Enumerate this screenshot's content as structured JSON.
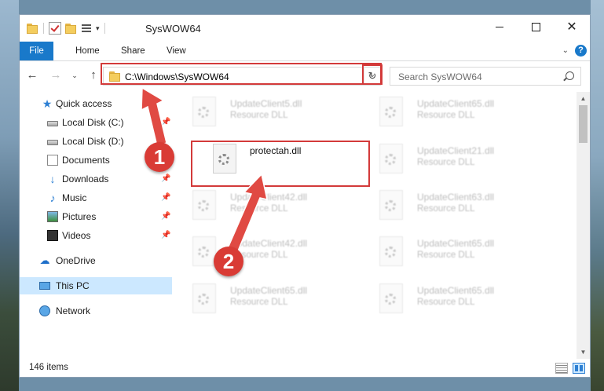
{
  "window": {
    "title": "SysWOW64",
    "qa_dropdown": "▾"
  },
  "ribbon": {
    "tabs": [
      {
        "label": "File"
      },
      {
        "label": "Home"
      },
      {
        "label": "Share"
      },
      {
        "label": "View"
      }
    ],
    "help": "?"
  },
  "nav": {
    "back": "←",
    "forward": "→",
    "recent": "⌄",
    "up": "↑",
    "address": "C:\\Windows\\SysWOW64",
    "address_dropdown": "⌄",
    "refresh": "↻",
    "search_placeholder": "Search SysWOW64"
  },
  "sidebar": {
    "items": [
      {
        "label": "Quick access",
        "icon": "star-icon"
      },
      {
        "label": "Local Disk (C:)",
        "icon": "drive-icon",
        "pinned": true
      },
      {
        "label": "Local Disk (D:)",
        "icon": "drive-icon",
        "pinned": false
      },
      {
        "label": "Documents",
        "icon": "documents-icon",
        "pinned": true
      },
      {
        "label": "Downloads",
        "icon": "download-icon",
        "pinned": true
      },
      {
        "label": "Music",
        "icon": "music-icon",
        "pinned": true
      },
      {
        "label": "Pictures",
        "icon": "pictures-icon",
        "pinned": true
      },
      {
        "label": "Videos",
        "icon": "videos-icon",
        "pinned": true
      },
      {
        "label": "OneDrive",
        "icon": "cloud-icon"
      },
      {
        "label": "This PC",
        "icon": "computer-icon",
        "selected": true
      },
      {
        "label": "Network",
        "icon": "network-icon"
      }
    ],
    "pin_glyph": "📌"
  },
  "files": {
    "items": [
      {
        "name": "UpdateClient5.dll",
        "type": "Resource DLL"
      },
      {
        "name": "UpdateClient65.dll",
        "type": "Resource DLL"
      },
      {
        "name": "protectah.dll",
        "type": ""
      },
      {
        "name": "UpdateClient21.dll",
        "type": "Resource DLL"
      },
      {
        "name": "UpdateClient42.dll",
        "type": "Resource DLL"
      },
      {
        "name": "UpdateClient63.dll",
        "type": "Resource DLL"
      },
      {
        "name": "UpdateClient42.dll",
        "type": "Resource DLL"
      },
      {
        "name": "UpdateClient65.dll",
        "type": "Resource DLL"
      },
      {
        "name": "UpdateClient65.dll",
        "type": "Resource DLL"
      },
      {
        "name": "UpdateClient65.dll",
        "type": "Resource DLL"
      }
    ]
  },
  "status": {
    "item_count": "146 items"
  },
  "annotations": {
    "step1": "1",
    "step2": "2",
    "color": "#d93b35"
  }
}
